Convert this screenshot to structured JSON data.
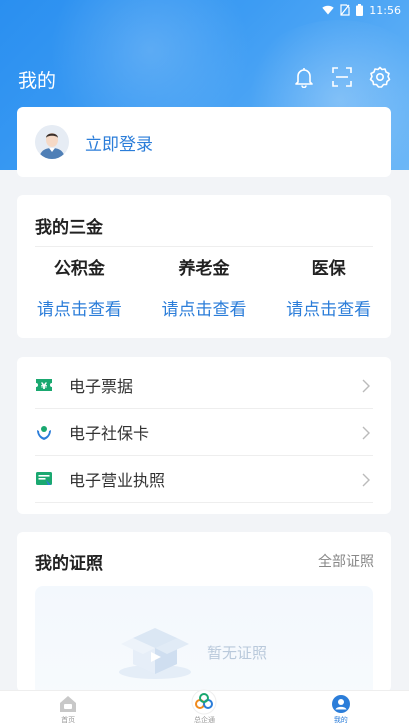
{
  "status_bar": {
    "time": "11:56"
  },
  "header": {
    "title": "我的",
    "icons": [
      "bell-icon",
      "scan-icon",
      "settings-icon"
    ]
  },
  "login": {
    "label": "立即登录"
  },
  "sanjin": {
    "title": "我的三金",
    "items": [
      {
        "name": "公积金",
        "link": "请点击查看"
      },
      {
        "name": "养老金",
        "link": "请点击查看"
      },
      {
        "name": "医保",
        "link": "请点击查看"
      }
    ]
  },
  "services": {
    "items": [
      {
        "label": "电子票据",
        "icon": "ticket-icon"
      },
      {
        "label": "电子社保卡",
        "icon": "social-security-icon"
      },
      {
        "label": "电子营业执照",
        "icon": "business-license-icon"
      }
    ]
  },
  "certs": {
    "title": "我的证照",
    "all_label": "全部证照",
    "empty_text": "暂无证照"
  },
  "bottom_nav": {
    "items": [
      {
        "label": "首页",
        "icon": "home-icon"
      },
      {
        "label": "总企通",
        "icon": "app-logo-icon"
      },
      {
        "label": "我的",
        "icon": "user-icon"
      }
    ]
  },
  "colors": {
    "brand_blue": "#2b7dd9",
    "header_gradient_start": "#2a8ff0",
    "service_green": "#1aa870"
  }
}
